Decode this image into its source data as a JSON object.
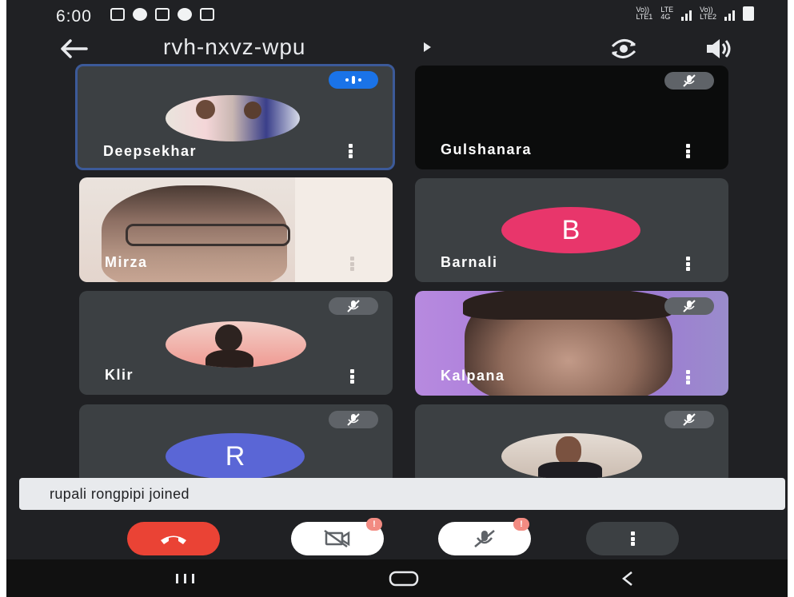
{
  "status_bar": {
    "time": "6:00",
    "sim1_label": "Vo))\nLTE1",
    "network_label": "LTE\n4G",
    "sim2_label": "Vo))\nLTE2"
  },
  "header": {
    "meeting_code": "rvh-nxvz-wpu"
  },
  "participants": [
    {
      "name": "Deepsekhar",
      "state": "speaking"
    },
    {
      "name": "Gulshanara",
      "state": "muted"
    },
    {
      "name": "Mirza",
      "state": "video"
    },
    {
      "name": "Barnali",
      "state": "avatar",
      "initial": "B"
    },
    {
      "name": "Klir",
      "state": "muted"
    },
    {
      "name": "Kalpana",
      "state": "muted"
    },
    {
      "name": "",
      "state": "muted",
      "initial": "R"
    },
    {
      "name": "",
      "state": "muted"
    }
  ],
  "toast": {
    "message": "rupali rongpipi joined"
  },
  "controls": {
    "video_alert": "!",
    "mic_alert": "!"
  },
  "colors": {
    "background": "#202124",
    "tile": "#3c4043",
    "end_call": "#ea4335",
    "avatar_b": "#e8366b",
    "avatar_r": "#5a66d6",
    "active_border": "#3c5a99"
  },
  "icons": {
    "back": "arrow-left-icon",
    "switch_camera": "switch-camera-icon",
    "speaker": "speaker-icon",
    "mic_off": "mic-off-icon",
    "video_off": "video-off-icon",
    "end_call": "phone-hangup-icon",
    "more": "more-vert-icon"
  }
}
